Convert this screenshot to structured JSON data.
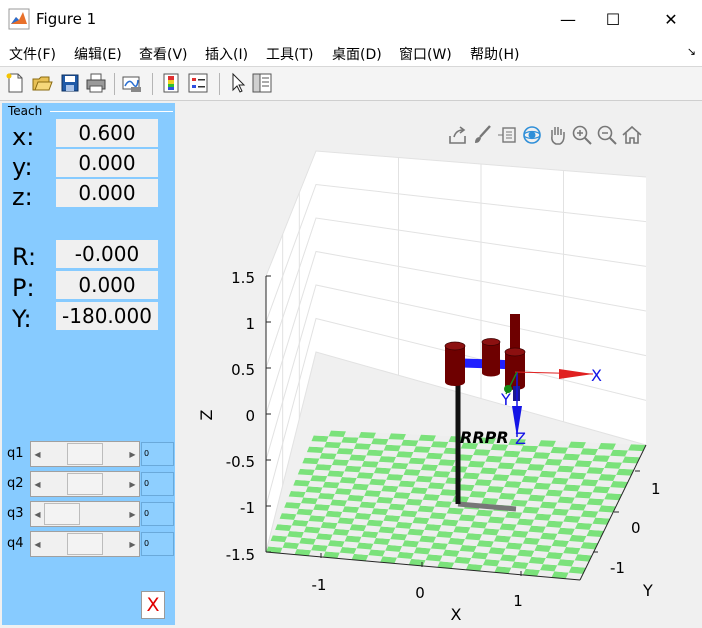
{
  "window": {
    "title": "Figure 1",
    "minimize": "—",
    "maximize": "☐",
    "close": "✕"
  },
  "menu": [
    {
      "label": "文件(F)"
    },
    {
      "label": "编辑(E)"
    },
    {
      "label": "查看(V)"
    },
    {
      "label": "插入(I)"
    },
    {
      "label": "工具(T)"
    },
    {
      "label": "桌面(D)"
    },
    {
      "label": "窗口(W)"
    },
    {
      "label": "帮助(H)"
    }
  ],
  "menu_arrow": "↘",
  "teach": {
    "title": "Teach",
    "pose": [
      {
        "label": "x:",
        "value": "0.600"
      },
      {
        "label": "y:",
        "value": "0.000"
      },
      {
        "label": "z:",
        "value": "0.000"
      },
      {
        "label": "R:",
        "value": "-0.000"
      },
      {
        "label": "P:",
        "value": "0.000"
      },
      {
        "label": "Y:",
        "value": "-180.000"
      }
    ],
    "joints": [
      {
        "label": "q1",
        "value": "0",
        "fraction": 0.5
      },
      {
        "label": "q2",
        "value": "0",
        "fraction": 0.5
      },
      {
        "label": "q3",
        "value": "0",
        "fraction": 0.0
      },
      {
        "label": "q4",
        "value": "0",
        "fraction": 0.5
      }
    ],
    "quit_label": "X"
  },
  "plot": {
    "robot_name": "RRPR",
    "frame_labels": {
      "x": "X",
      "y": "Y",
      "z": "Z"
    },
    "axis_labels": {
      "x": "X",
      "y": "Y",
      "z": "Z"
    },
    "x_ticks": [
      "-1",
      "0",
      "1"
    ],
    "y_ticks": [
      "1",
      "0",
      "-1"
    ],
    "z_ticks": [
      "1.5",
      "1",
      "0.5",
      "0",
      "-0.5",
      "-1",
      "-1.5"
    ],
    "colors": {
      "floor_green": "#7be27b",
      "floor_white": "#eeeeee",
      "link_red": "#6e0000",
      "joint_blue": "#1515e6",
      "axis_x": "#e02020",
      "axis_z": "#1515e6"
    }
  },
  "axes_toolbar": [
    "export-icon",
    "brush-icon",
    "datatip-icon",
    "rotate-icon",
    "pan-icon",
    "zoom-in-icon",
    "zoom-out-icon",
    "home-icon"
  ],
  "toolbar": [
    "new-figure-icon",
    "open-file-icon",
    "save-icon",
    "print-icon",
    "link-plot-icon",
    "insert-colorbar-icon",
    "insert-legend-icon",
    "edit-plot-icon",
    "property-inspector-icon"
  ]
}
